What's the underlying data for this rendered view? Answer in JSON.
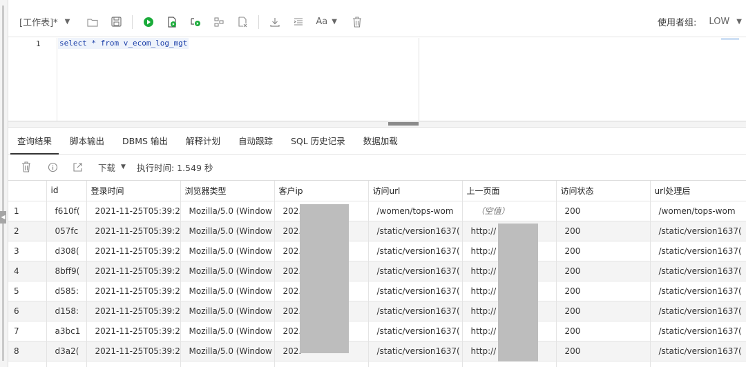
{
  "toolbar": {
    "worksheet_label": "[工作表]*",
    "font_label": "Aa",
    "consumer_group_label": "使用者组:",
    "consumer_group_value": "LOW",
    "icons": [
      "folder-icon",
      "save-icon",
      "run-icon",
      "run-script-icon",
      "explain-plan-icon",
      "autotrace-icon",
      "clear-icon",
      "download-icon",
      "format-icon",
      "font-icon",
      "trash-icon"
    ],
    "run_color": "#1aab3a"
  },
  "editor": {
    "line_number": "1",
    "sql": "select * from v_ecom_log_mgt"
  },
  "tabs": [
    {
      "label": "查询结果",
      "active": true
    },
    {
      "label": "脚本输出"
    },
    {
      "label": "DBMS 输出"
    },
    {
      "label": "解释计划"
    },
    {
      "label": "自动跟踪"
    },
    {
      "label": "SQL 历史记录"
    },
    {
      "label": "数据加载"
    }
  ],
  "result_bar": {
    "download_label": "下载",
    "exec_time": "执行时间: 1.549 秒"
  },
  "grid": {
    "columns": [
      "",
      "id",
      "登录时间",
      "浏览器类型",
      "客户ip",
      "访问url",
      "上一页面",
      "访问状态",
      "url处理后"
    ],
    "rows": [
      [
        "1",
        "f610f(",
        "2021-11-25T05:39:2",
        "Mozilla/5.0 (Window",
        "202.",
        "/women/tops-wom",
        "（空值）",
        "200",
        "/women/tops-wom"
      ],
      [
        "2",
        "057fc",
        "2021-11-25T05:39:2",
        "Mozilla/5.0 (Window",
        "202.",
        "/static/version1637(",
        "http://",
        "200",
        "/static/version1637("
      ],
      [
        "3",
        "d308(",
        "2021-11-25T05:39:2",
        "Mozilla/5.0 (Window",
        "202.",
        "/static/version1637(",
        "http://",
        "200",
        "/static/version1637("
      ],
      [
        "4",
        "8bff9(",
        "2021-11-25T05:39:2",
        "Mozilla/5.0 (Window",
        "202.",
        "/static/version1637(",
        "http://",
        "200",
        "/static/version1637("
      ],
      [
        "5",
        "d585:",
        "2021-11-25T05:39:2",
        "Mozilla/5.0 (Window",
        "202.",
        "/static/version1637(",
        "http://",
        "200",
        "/static/version1637("
      ],
      [
        "6",
        "d158:",
        "2021-11-25T05:39:2",
        "Mozilla/5.0 (Window",
        "202.",
        "/static/version1637(",
        "http://",
        "200",
        "/static/version1637("
      ],
      [
        "7",
        "a3bc1",
        "2021-11-25T05:39:2",
        "Mozilla/5.0 (Window",
        "202.",
        "/static/version1637(",
        "http://",
        "200",
        "/static/version1637("
      ],
      [
        "8",
        "d3a2(",
        "2021-11-25T05:39:2",
        "Mozilla/5.0 (Window",
        "202.",
        "/static/version1637(",
        "http://",
        "200",
        "/static/version1637("
      ]
    ],
    "null_cell": "（空值）"
  }
}
